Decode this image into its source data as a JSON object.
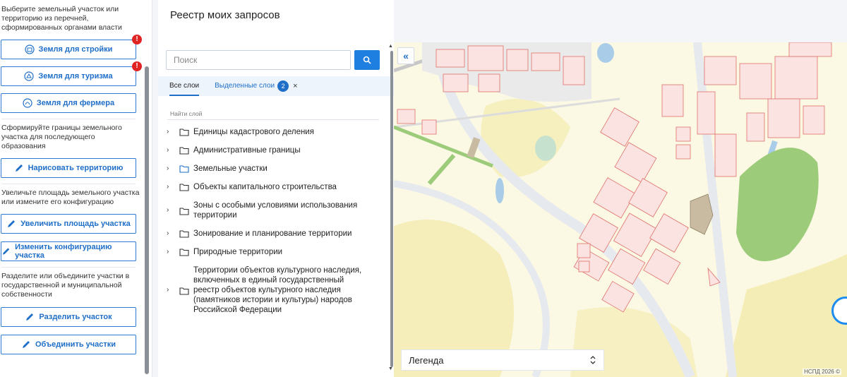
{
  "left_panel": {
    "section1_hint": "Выберите земельный участок или территорию из перечней, сформированных органами власти",
    "btn_land_build": "Земля для стройки",
    "btn_land_tourism": "Земля для туризма",
    "btn_land_farmer": "Земля для фермера",
    "error_badge": "!",
    "section2_hint": "Сформируйте границы земельного участка для последующего образования",
    "btn_draw": "Нарисовать территорию",
    "section3_hint": "Увеличьте площадь земельного участка или измените его конфигурацию",
    "btn_increase": "Увеличить площадь участка",
    "btn_change": "Изменить конфигурацию участка",
    "section4_hint": "Разделите или объедините участки в государственной и муниципальной собственности",
    "btn_split": "Разделить участок",
    "btn_merge": "Объединить участки"
  },
  "layers_panel": {
    "title": "Реестр моих запросов",
    "search_placeholder": "Поиск",
    "tab_all": "Все слои",
    "tab_selected": "Выделенные слои",
    "selected_count": "2",
    "close_symbol": "×",
    "find_layer_label": "Найти слой",
    "items": [
      {
        "label": "Единицы кадастрового деления"
      },
      {
        "label": "Административные границы"
      },
      {
        "label": "Земельные участки"
      },
      {
        "label": "Объекты капитального строительства"
      },
      {
        "label": "Зоны с особыми условиями использования территории"
      },
      {
        "label": "Зонирование и планирование территории"
      },
      {
        "label": "Природные территории"
      },
      {
        "label": "Территории объектов культурного наследия, включенных в единый государственный реестр объектов культурного наследия (памятников истории и культуры) народов Российской Федерации"
      }
    ]
  },
  "map": {
    "collapse_symbol": "«",
    "legend_label": "Легенда",
    "legend_toggle_symbol": "⌃⌄",
    "attribution": "НСПД 2026 ©"
  },
  "colors": {
    "accent": "#1f6fc9",
    "error": "#e02424",
    "parcel_stroke": "#e0706a",
    "parcel_fill": "#fbe3e1",
    "forest": "#9ccc7a",
    "field": "#f6efbe",
    "water": "#a9cde8"
  }
}
